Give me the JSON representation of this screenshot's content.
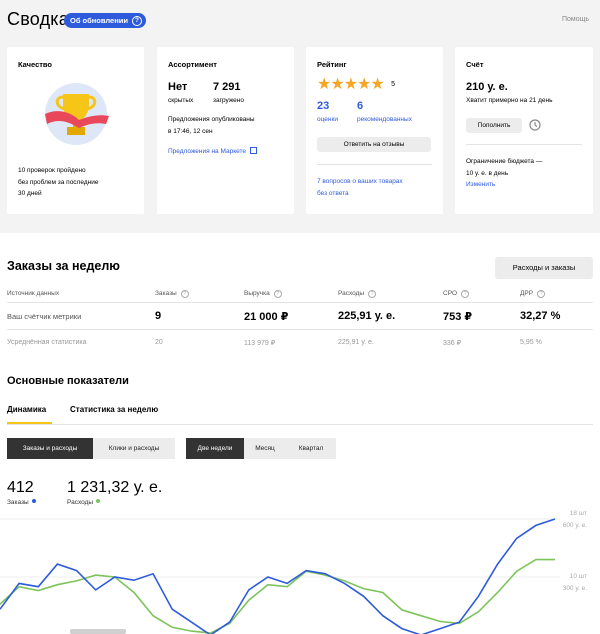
{
  "header": {
    "title": "Сводка",
    "updates_badge": "Об обновлении",
    "help": "Помощь"
  },
  "cards": {
    "quality": {
      "title": "Качество",
      "text1": "10 проверок пройдено",
      "text2": "без проблем за последние",
      "text3": "30 дней"
    },
    "assortment": {
      "title": "Ассортимент",
      "hidden_value": "Нет",
      "hidden_label": "скрытых",
      "loaded_value": "7 291",
      "loaded_label": "загружено",
      "published1": "Предложения опубликованы",
      "published2": "в 17:46, 12 сен",
      "market_link": "Предложения на Маркете"
    },
    "rating": {
      "title": "Рейтинг",
      "stars": 5,
      "value": "5",
      "reviews_count": "23",
      "reviews_label": "оценки",
      "recommend_count": "6",
      "recommend_label": "рекомендованных",
      "answer_button": "Ответить на отзывы",
      "questions1": "7 вопросов о ваших товарах",
      "questions2": "без ответа"
    },
    "account": {
      "title": "Счёт",
      "amount": "210 у. е.",
      "enough": "Хватит примерно на 21 день",
      "topup_button": "Пополнить",
      "limit1": "Ограничение бюджета —",
      "limit2": "10 у. е. в день",
      "change_link": "Изменить"
    }
  },
  "orders": {
    "title": "Заказы за неделю",
    "expenses_button": "Расходы и заказы",
    "columns": [
      "Источник данных",
      "Заказы",
      "Выручка",
      "Расходы",
      "CPO",
      "ДРР"
    ],
    "row1": [
      "Ваш счётчик метрики",
      "9",
      "21 000 ₽",
      "225,91 у. е.",
      "753 ₽",
      "32,27 %"
    ],
    "row2": [
      "Усреднённая статистика",
      "20",
      "113 979 ₽",
      "225,91 у. е.",
      "336 ₽",
      "5,95 %"
    ]
  },
  "metrics": {
    "title": "Основные показатели",
    "tabs": [
      "Динамика",
      "Статистика за неделю"
    ],
    "seg1": [
      "Заказы и расходы",
      "Клики и расходы"
    ],
    "seg2": [
      "Две недели",
      "Месяц",
      "Квартал"
    ],
    "orders_value": "412",
    "orders_label": "Заказы",
    "expenses_value": "1 231,32 у. е.",
    "expenses_label": "Расходы",
    "axis_top1": "18 шт",
    "axis_top2": "600 у. е.",
    "axis_mid1": "10 шт",
    "axis_mid2": "300 у. е."
  },
  "colors": {
    "accent": "#2d5bdc",
    "orders_line": "#2d5bdc",
    "expenses_line": "#7cc45a"
  },
  "chart_data": {
    "type": "line",
    "series": [
      {
        "name": "Заказы",
        "values": [
          4,
          8,
          7.5,
          11,
          10,
          7,
          9,
          8.5,
          9.5,
          4,
          2,
          0,
          2,
          7,
          9,
          8,
          10,
          9.5,
          8,
          6,
          3,
          1,
          0,
          1,
          2,
          6,
          11,
          15,
          17,
          18
        ]
      },
      {
        "name": "Расходы",
        "values": [
          160,
          250,
          230,
          260,
          280,
          310,
          300,
          220,
          100,
          40,
          20,
          10,
          60,
          180,
          260,
          250,
          330,
          310,
          280,
          240,
          220,
          130,
          100,
          70,
          60,
          120,
          220,
          330,
          390,
          390
        ]
      }
    ],
    "ylim_orders": [
      0,
      18
    ],
    "ylim_expenses": [
      0,
      600
    ]
  }
}
